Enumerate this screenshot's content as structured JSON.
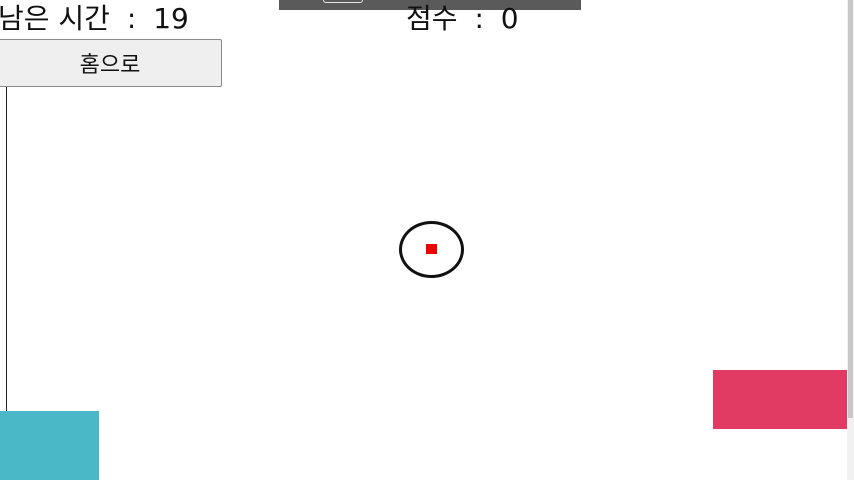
{
  "hud": {
    "time_label": "남은 시간",
    "time_separator": ":",
    "time_value": "19",
    "score_label": "점수",
    "score_separator": ":",
    "score_value": "0"
  },
  "home_button": {
    "label": "홈으로"
  },
  "colors": {
    "target_dot": "#ee0000",
    "target_ring": "#111111",
    "teal_block": "#4ab8c7",
    "pink_block": "#e23b63",
    "top_bar": "#5a5a5a"
  }
}
